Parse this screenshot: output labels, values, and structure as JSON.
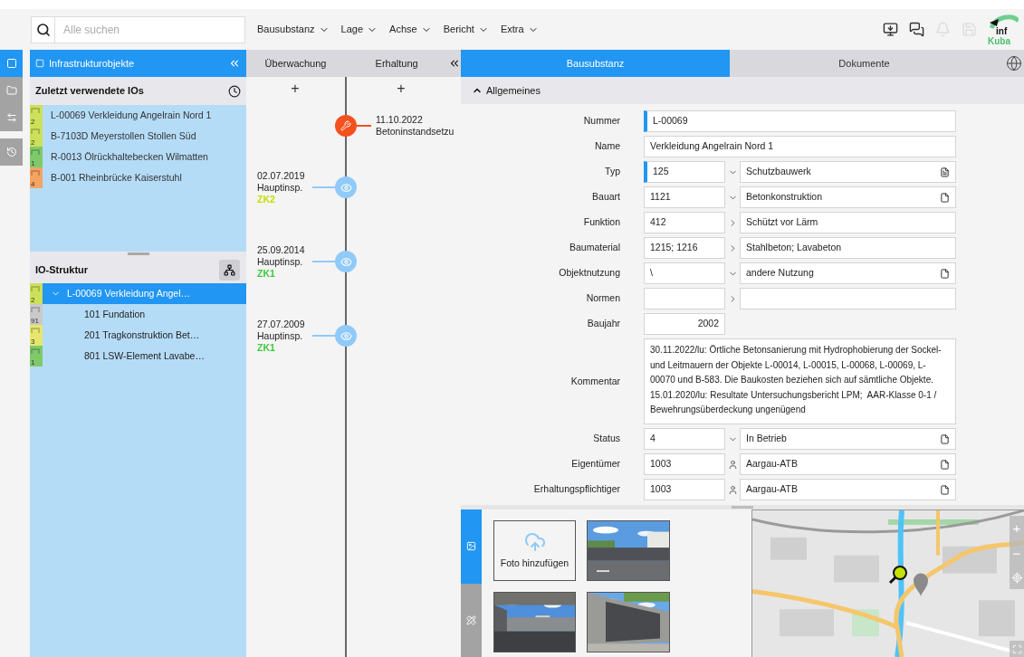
{
  "search": {
    "placeholder": "Alle suchen"
  },
  "menu": [
    {
      "label": "Bausubstanz"
    },
    {
      "label": "Lage"
    },
    {
      "label": "Achse"
    },
    {
      "label": "Bericht"
    },
    {
      "label": "Extra"
    }
  ],
  "toolbar_icons": [
    {
      "kind": "download",
      "disabled": false
    },
    {
      "kind": "chat",
      "disabled": false
    },
    {
      "kind": "bell",
      "disabled": true
    },
    {
      "kind": "save",
      "disabled": true
    }
  ],
  "logo": {
    "line_1": "inf",
    "line_2": "Kuba"
  },
  "side_tabs": [
    {
      "kind": "objects",
      "selected": true
    },
    {
      "kind": "folder",
      "selected": false
    },
    {
      "kind": "swap",
      "selected": false
    },
    {
      "kind": "history",
      "selected": false
    }
  ],
  "objects_panel": {
    "title": "Infrastrukturobjekte"
  },
  "recent": {
    "title": "Zuletzt verwendete IOs",
    "items": [
      {
        "label": "L-00069 Verkleidung Angelrain Nord 1",
        "badge": "2",
        "color": "#cde05a"
      },
      {
        "label": "B-7103D Meyerstollen Stollen Süd",
        "badge": "2",
        "color": "#cde05a"
      },
      {
        "label": "R-0013 Ölrückhaltebecken Wilmatten",
        "badge": "1",
        "color": "#7fc96b"
      },
      {
        "label": "B-001 Rheinbrücke Kaiserstuhl",
        "badge": "4",
        "color": "#f4a462"
      }
    ]
  },
  "structure": {
    "title": "IO-Struktur",
    "tree": [
      {
        "label": "L-00069 Verkleidung Angel…",
        "badge": "2",
        "color": "#cde05a",
        "selected": true,
        "expanded": true,
        "children": [
          {
            "label": "101 Fundation",
            "badge": "91",
            "color": "#c9c9c9",
            "selected": false
          },
          {
            "label": "201 Tragkonstruktion Bet…",
            "badge": "3",
            "color": "#e6e66e",
            "selected": false
          },
          {
            "label": "801 LSW-Element Lavabe…",
            "badge": "1",
            "color": "#7fc96b",
            "selected": false
          }
        ]
      }
    ]
  },
  "timeline": {
    "columns": [
      {
        "label": "Überwachung",
        "add": "+"
      },
      {
        "label": "Erhaltung",
        "add": "+"
      }
    ],
    "events": [
      {
        "kind": "maintenance",
        "date": "11.10.2022",
        "label": "Betoninstandsetzu"
      },
      {
        "kind": "inspection",
        "date": "02.07.2019",
        "label": "Hauptinsp.",
        "rating": "ZK2",
        "color": "#c3e000"
      },
      {
        "kind": "inspection",
        "date": "25.09.2014",
        "label": "Hauptinsp.",
        "rating": "ZK1",
        "color": "#3cc83c"
      },
      {
        "kind": "inspection",
        "date": "27.07.2009",
        "label": "Hauptinsp.",
        "rating": "ZK1",
        "color": "#3cc83c"
      }
    ]
  },
  "tabs": [
    {
      "label": "Bausubstanz",
      "selected": true
    },
    {
      "label": "Dokumente",
      "selected": false
    }
  ],
  "section": {
    "title": "Allgemeines",
    "expanded": true
  },
  "fields": [
    {
      "kind": "text",
      "label": "Nummer",
      "value": "L-00069",
      "required": true
    },
    {
      "kind": "text",
      "label": "Name",
      "value": "Verkleidung Angelrain Nord 1",
      "required": false
    },
    {
      "kind": "pair",
      "label": "Typ",
      "code": "125",
      "connector": {
        "kind": "dropdown"
      },
      "text": "Schutzbauwerk",
      "doc": {
        "kind": "lines"
      },
      "required": true
    },
    {
      "kind": "pair",
      "label": "Bauart",
      "code": "1121",
      "connector": {
        "kind": "dropdown"
      },
      "text": "Betonkonstruktion",
      "doc": {
        "kind": "blank"
      },
      "required": false
    },
    {
      "kind": "pair",
      "label": "Funktion",
      "code": "412",
      "connector": {
        "kind": "arrow"
      },
      "text": "Schützt vor Lärm",
      "required": false
    },
    {
      "kind": "pair",
      "label": "Baumaterial",
      "code": "1215; 1216",
      "connector": {
        "kind": "arrow"
      },
      "text": "Stahlbeton; Lavabeton",
      "required": false
    },
    {
      "kind": "pair",
      "label": "Objektnutzung",
      "code": "\\",
      "connector": {
        "kind": "dropdown"
      },
      "text": "andere Nutzung",
      "doc": {
        "kind": "blank"
      },
      "required": false
    },
    {
      "kind": "pair",
      "label": "Normen",
      "connector": {
        "kind": "arrow"
      },
      "required": false
    },
    {
      "kind": "number",
      "label": "Baujahr",
      "value": "2002",
      "required": false
    },
    {
      "kind": "textarea",
      "label": "Kommentar",
      "value": "30.11.2022/lu: Örtliche Betonsanierung mit Hydrophobierung der Sockel- und Leitmauern der Objekte L-00014, L-00015, L-00068, L-00069, L-00070 und B-583. Die Baukosten beziehen sich auf sämtliche Objekte.\n15.01.2020/lu: Resultate Untersuchungsbericht LPM;  AAR-Klasse 0-1 / Bewehrungsüberdeckung ungenügend",
      "required": false
    },
    {
      "kind": "pair",
      "label": "Status",
      "code": "4",
      "connector": {
        "kind": "dropdown"
      },
      "text": "In Betrieb",
      "doc": {
        "kind": "blank"
      },
      "required": false
    },
    {
      "kind": "pair",
      "label": "Eigentümer",
      "code": "1003",
      "connector": {
        "kind": "person"
      },
      "text": "Aargau-ATB",
      "doc": {
        "kind": "blank"
      },
      "required": false
    },
    {
      "kind": "pair",
      "label": "Erhaltungspflichtiger",
      "code": "1003",
      "connector": {
        "kind": "person"
      },
      "text": "Aargau-ATB",
      "doc": {
        "kind": "blank"
      },
      "required": false
    }
  ],
  "bottom_tabs": [
    {
      "kind": "photos",
      "selected": true
    },
    {
      "kind": "tools",
      "selected": false
    }
  ],
  "photos": {
    "upload_label": "Foto hinzufügen"
  },
  "map": {
    "kind": "picture",
    "controls": [
      "+",
      "−"
    ]
  }
}
